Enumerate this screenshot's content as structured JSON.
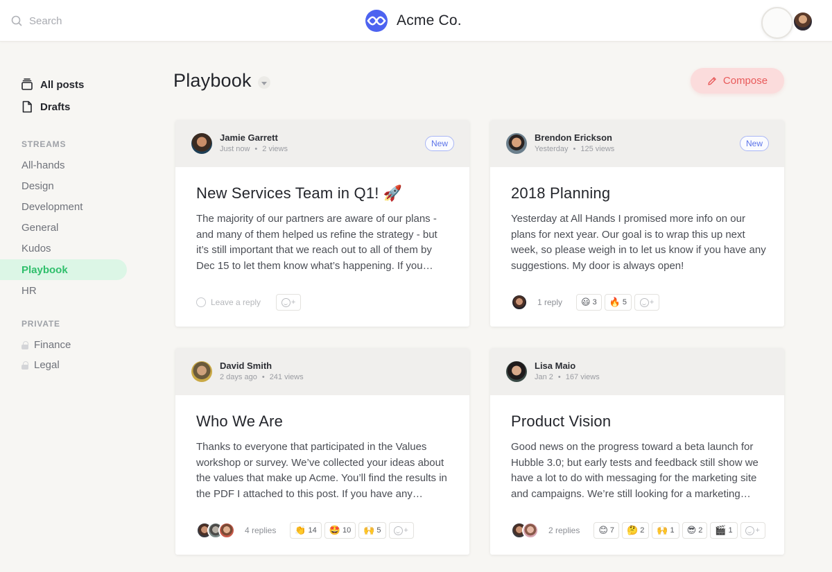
{
  "header": {
    "search_placeholder": "Search",
    "brand_name": "Acme Co."
  },
  "sidebar": {
    "main": [
      {
        "label": "All posts",
        "icon": "stack-icon"
      },
      {
        "label": "Drafts",
        "icon": "document-icon"
      }
    ],
    "streams_label": "STREAMS",
    "streams": [
      {
        "label": "All-hands"
      },
      {
        "label": "Design"
      },
      {
        "label": "Development"
      },
      {
        "label": "General"
      },
      {
        "label": "Kudos"
      },
      {
        "label": "Playbook",
        "active": true
      },
      {
        "label": "HR"
      }
    ],
    "private_label": "PRIVATE",
    "private": [
      {
        "label": "Finance",
        "icon": "lock-icon"
      },
      {
        "label": "Legal",
        "icon": "lock-icon"
      }
    ]
  },
  "main": {
    "title": "Playbook",
    "compose_label": "Compose",
    "posts": [
      {
        "author": "Jamie Garrett",
        "time": "Just now",
        "views": "2 views",
        "badge": "New",
        "title": "New Services Team in Q1! 🚀",
        "body": "The majority of our partners are aware of our plans - and many of them helped us refine the strategy - but it’s still important that we reach out to all of them by Dec 15 to let them know what’s happening. If you…",
        "reply_placeholder": "Leave a reply",
        "replies": "",
        "reactions": []
      },
      {
        "author": "Brendon Erickson",
        "time": "Yesterday",
        "views": "125 views",
        "badge": "New",
        "title": "2018 Planning",
        "body": "Yesterday at All Hands I promised more info on our plans for next year. Our goal is to wrap this up next week, so please weigh in to let us know if you have any suggestions. My door is always open!",
        "reply_placeholder": "",
        "replies": "1 reply",
        "reactions": [
          {
            "emoji": "😃",
            "count": "3"
          },
          {
            "emoji": "🔥",
            "count": "5"
          }
        ]
      },
      {
        "author": "David Smith",
        "time": "2 days ago",
        "views": "241 views",
        "badge": "",
        "title": "Who We Are",
        "body": "Thanks to everyone that participated in the Values workshop or survey. We’ve collected your ideas about the values that make up Acme. You’ll find the results in the PDF I attached to this post. If you have any…",
        "reply_placeholder": "",
        "replies": "4 replies",
        "reactions": [
          {
            "emoji": "👏",
            "count": "14"
          },
          {
            "emoji": "🤩",
            "count": "10"
          },
          {
            "emoji": "🙌",
            "count": "5"
          }
        ]
      },
      {
        "author": "Lisa Maio",
        "time": "Jan 2",
        "views": "167 views",
        "badge": "",
        "title": "Product Vision",
        "body": "Good news on the progress toward a beta launch for Hubble 3.0; but early tests and feedback still show we have a lot to do with messaging for the marketing site and campaigns. We’re still looking for a marketing…",
        "reply_placeholder": "",
        "replies": "2 replies",
        "reactions": [
          {
            "emoji": "😊",
            "count": "7"
          },
          {
            "emoji": "🤔",
            "count": "2"
          },
          {
            "emoji": "🙌",
            "count": "1"
          },
          {
            "emoji": "😎",
            "count": "2"
          },
          {
            "emoji": "🎬",
            "count": "1"
          }
        ]
      }
    ]
  },
  "colors": {
    "accent_green": "#2fbf6b",
    "compose_red": "#e85a5a",
    "badge_blue": "#5a72e8",
    "brand_blue": "#4d63f0"
  }
}
